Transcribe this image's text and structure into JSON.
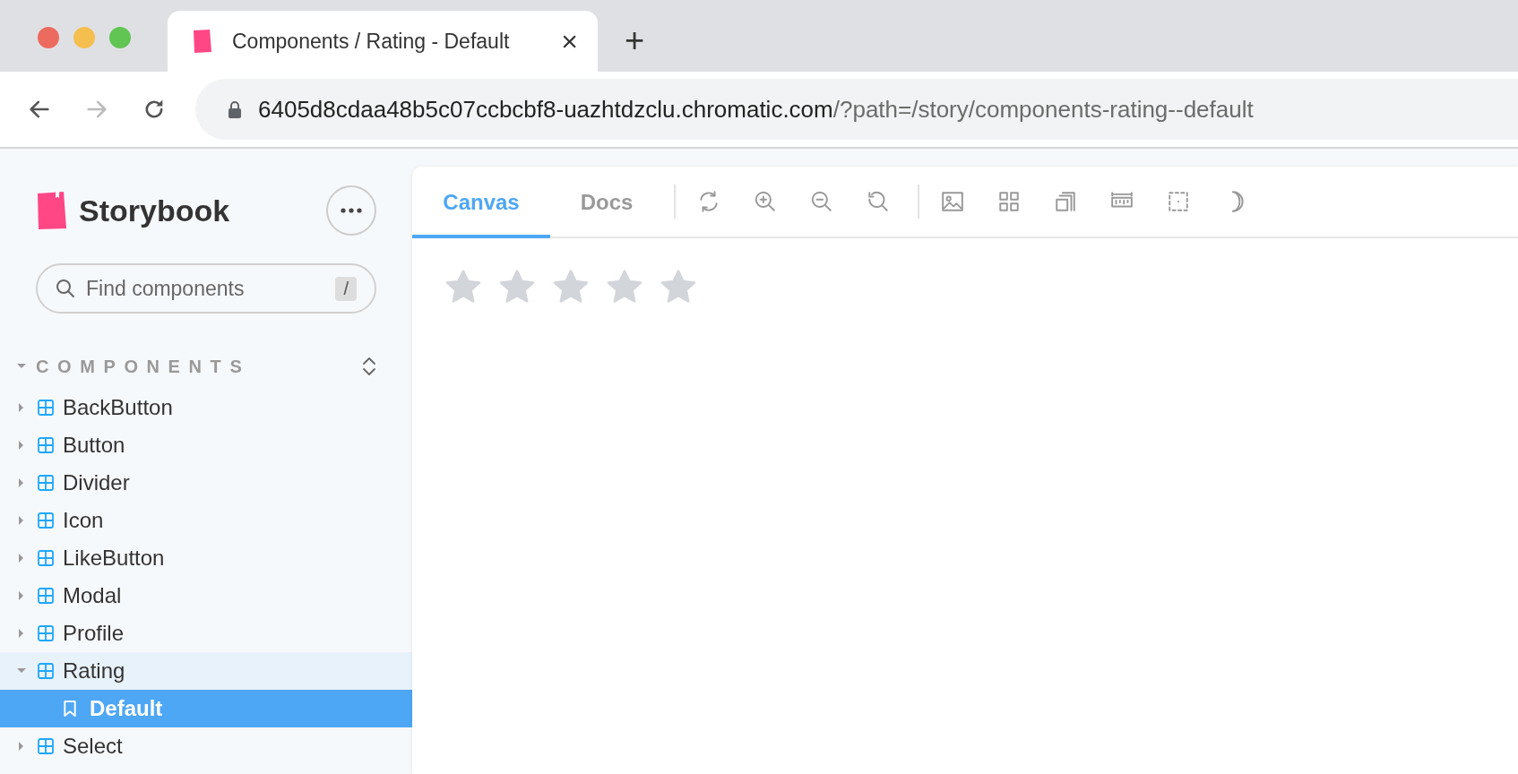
{
  "browser": {
    "tab_title": "Components / Rating - Default",
    "tab_close": "×",
    "new_tab": "+",
    "nav": [
      {
        "kind": "back",
        "disabled": false
      },
      {
        "kind": "forward",
        "disabled": true
      },
      {
        "kind": "reload",
        "disabled": false
      }
    ],
    "url_host": "6405d8cdaa48b5c07ccbcbf8-uazhtdzclu.chromatic.com",
    "url_path": "/?path=/story/components-rating--default"
  },
  "sidebar": {
    "brand": "Storybook",
    "search": {
      "placeholder": "Find components",
      "shortcut": "/"
    },
    "section": {
      "title": "COMPONENTS",
      "expanded": true
    },
    "items": [
      {
        "label": "BackButton",
        "kind": "component",
        "expanded": false,
        "selected": false
      },
      {
        "label": "Button",
        "kind": "component",
        "expanded": false,
        "selected": false
      },
      {
        "label": "Divider",
        "kind": "component",
        "expanded": false,
        "selected": false
      },
      {
        "label": "Icon",
        "kind": "component",
        "expanded": false,
        "selected": false
      },
      {
        "label": "LikeButton",
        "kind": "component",
        "expanded": false,
        "selected": false
      },
      {
        "label": "Modal",
        "kind": "component",
        "expanded": false,
        "selected": false
      },
      {
        "label": "Profile",
        "kind": "component",
        "expanded": false,
        "selected": false
      },
      {
        "label": "Rating",
        "kind": "component",
        "expanded": true,
        "selected": false,
        "children": [
          {
            "label": "Default",
            "kind": "story",
            "selected": true
          }
        ]
      },
      {
        "label": "Select",
        "kind": "component",
        "expanded": false,
        "selected": false
      }
    ]
  },
  "preview": {
    "tabs": [
      {
        "label": "Canvas",
        "selected": true
      },
      {
        "label": "Docs",
        "selected": false
      }
    ],
    "rating": {
      "stars": 0
    }
  }
}
